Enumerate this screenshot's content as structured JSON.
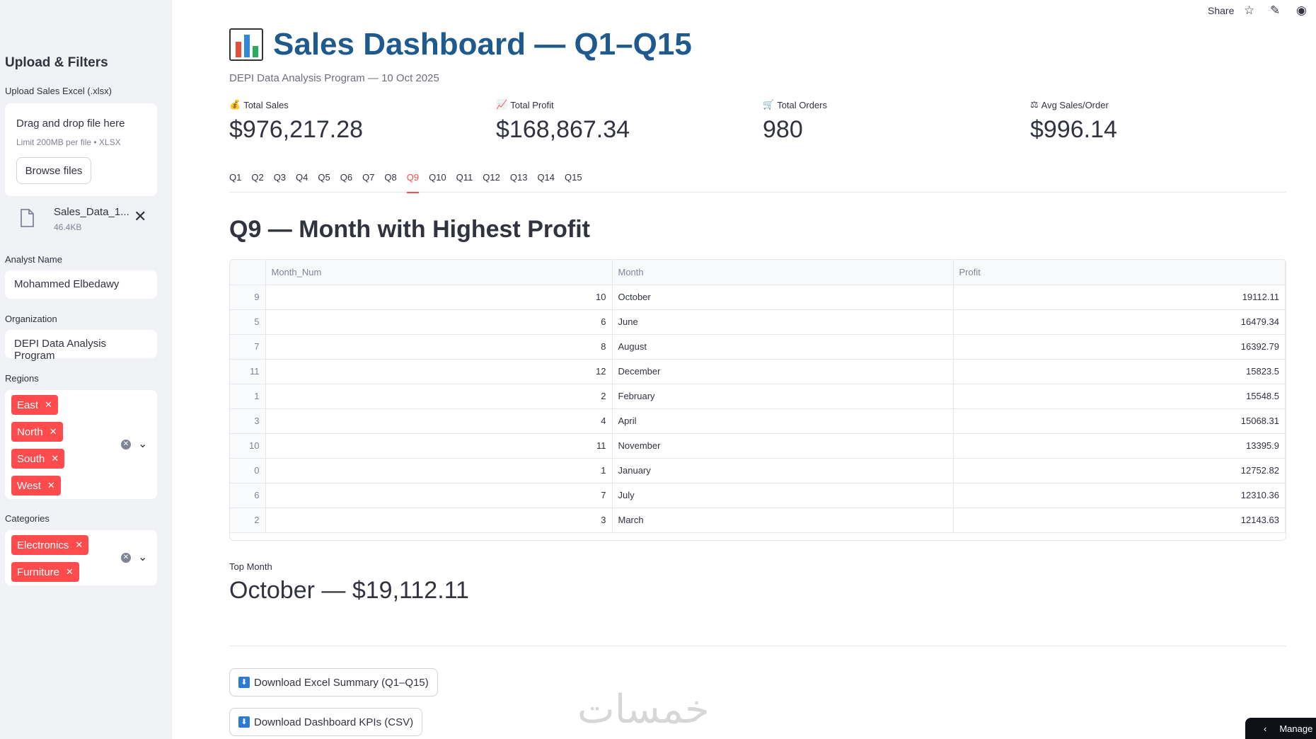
{
  "sidebar": {
    "title": "Upload & Filters",
    "upload_label": "Upload Sales Excel (.xlsx)",
    "uploader": {
      "drag_text": "Drag and drop file here",
      "limit_text": "Limit 200MB per file • XLSX",
      "browse_label": "Browse files"
    },
    "file": {
      "name": "Sales_Data_1...",
      "size": "46.4KB"
    },
    "analyst_label": "Analyst Name",
    "analyst_value": "Mohammed Elbedawy",
    "org_label": "Organization",
    "org_value": "DEPI Data Analysis Program",
    "regions_label": "Regions",
    "regions": [
      "East",
      "North",
      "South",
      "West"
    ],
    "categories_label": "Categories",
    "categories": [
      "Electronics",
      "Furniture"
    ]
  },
  "toolbar": {
    "share_label": "Share",
    "icons": [
      "star-icon",
      "pencil-icon",
      "github-icon"
    ]
  },
  "header": {
    "title": "Sales Dashboard — Q1–Q15",
    "subtitle": "DEPI Data Analysis Program — 10 Oct 2025"
  },
  "kpis": [
    {
      "label": "Total Sales",
      "value": "$976,217.28",
      "icon": "money-bag-icon"
    },
    {
      "label": "Total Profit",
      "value": "$168,867.34",
      "icon": "chart-up-icon"
    },
    {
      "label": "Total Orders",
      "value": "980",
      "icon": "cart-icon"
    },
    {
      "label": "Avg Sales/Order",
      "value": "$996.14",
      "icon": "scale-icon"
    }
  ],
  "tabs": [
    "Q1",
    "Q2",
    "Q3",
    "Q4",
    "Q5",
    "Q6",
    "Q7",
    "Q8",
    "Q9",
    "Q10",
    "Q11",
    "Q12",
    "Q13",
    "Q14",
    "Q15"
  ],
  "active_tab": "Q9",
  "section_title": "Q9 — Month with Highest Profit",
  "table": {
    "columns": [
      "Month_Num",
      "Month",
      "Profit"
    ],
    "rows": [
      [
        "9",
        "10",
        "October",
        "19112.11"
      ],
      [
        "5",
        "6",
        "June",
        "16479.34"
      ],
      [
        "7",
        "8",
        "August",
        "16392.79"
      ],
      [
        "11",
        "12",
        "December",
        "15823.5"
      ],
      [
        "1",
        "2",
        "February",
        "15548.5"
      ],
      [
        "3",
        "4",
        "April",
        "15068.31"
      ],
      [
        "10",
        "11",
        "November",
        "13395.9"
      ],
      [
        "0",
        "1",
        "January",
        "12752.82"
      ],
      [
        "6",
        "7",
        "July",
        "12310.36"
      ],
      [
        "2",
        "3",
        "March",
        "12143.63"
      ]
    ]
  },
  "top_month": {
    "label": "Top Month",
    "value": "October — $19,112.11"
  },
  "downloads": [
    "Download Excel Summary (Q1–Q15)",
    "Download Dashboard KPIs (CSV)"
  ],
  "watermark": "خمسات",
  "manage_label": "Manage"
}
